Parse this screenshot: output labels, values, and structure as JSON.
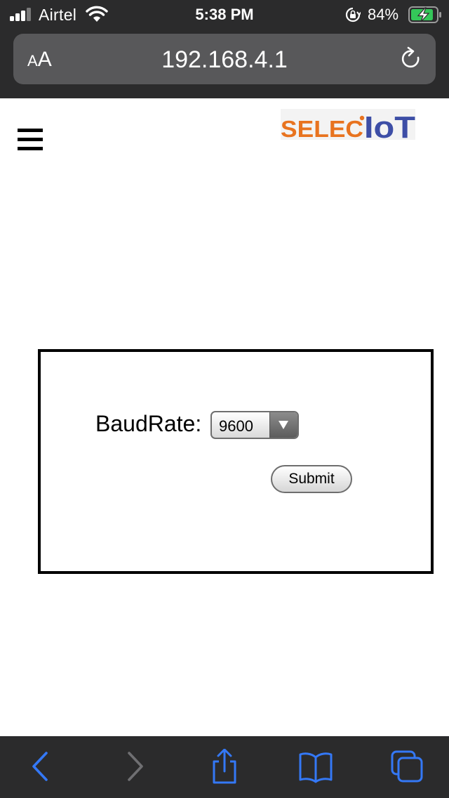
{
  "status_bar": {
    "carrier": "Airtel",
    "time": "5:38 PM",
    "battery_percent": "84%",
    "signal_bars": 3,
    "icons": [
      "signal-icon",
      "wifi-icon",
      "rotation-lock-icon",
      "battery-charging-icon"
    ]
  },
  "browser": {
    "text_size_small": "A",
    "text_size_big": "A",
    "url": "192.168.4.1",
    "reload_icon": "reload-icon"
  },
  "page": {
    "menu_icon": "hamburger-menu-icon",
    "logo": {
      "text_left": "SELEC",
      "text_right": "IoT",
      "color_left": "#e8731f",
      "color_right": "#3d4ea6"
    },
    "form": {
      "label": "BaudRate:",
      "select_value": "9600",
      "submit_label": "Submit"
    }
  },
  "toolbar": {
    "items": [
      "back-icon",
      "forward-icon",
      "share-icon",
      "bookmarks-icon",
      "tabs-icon"
    ],
    "accent": "#3478f6"
  }
}
